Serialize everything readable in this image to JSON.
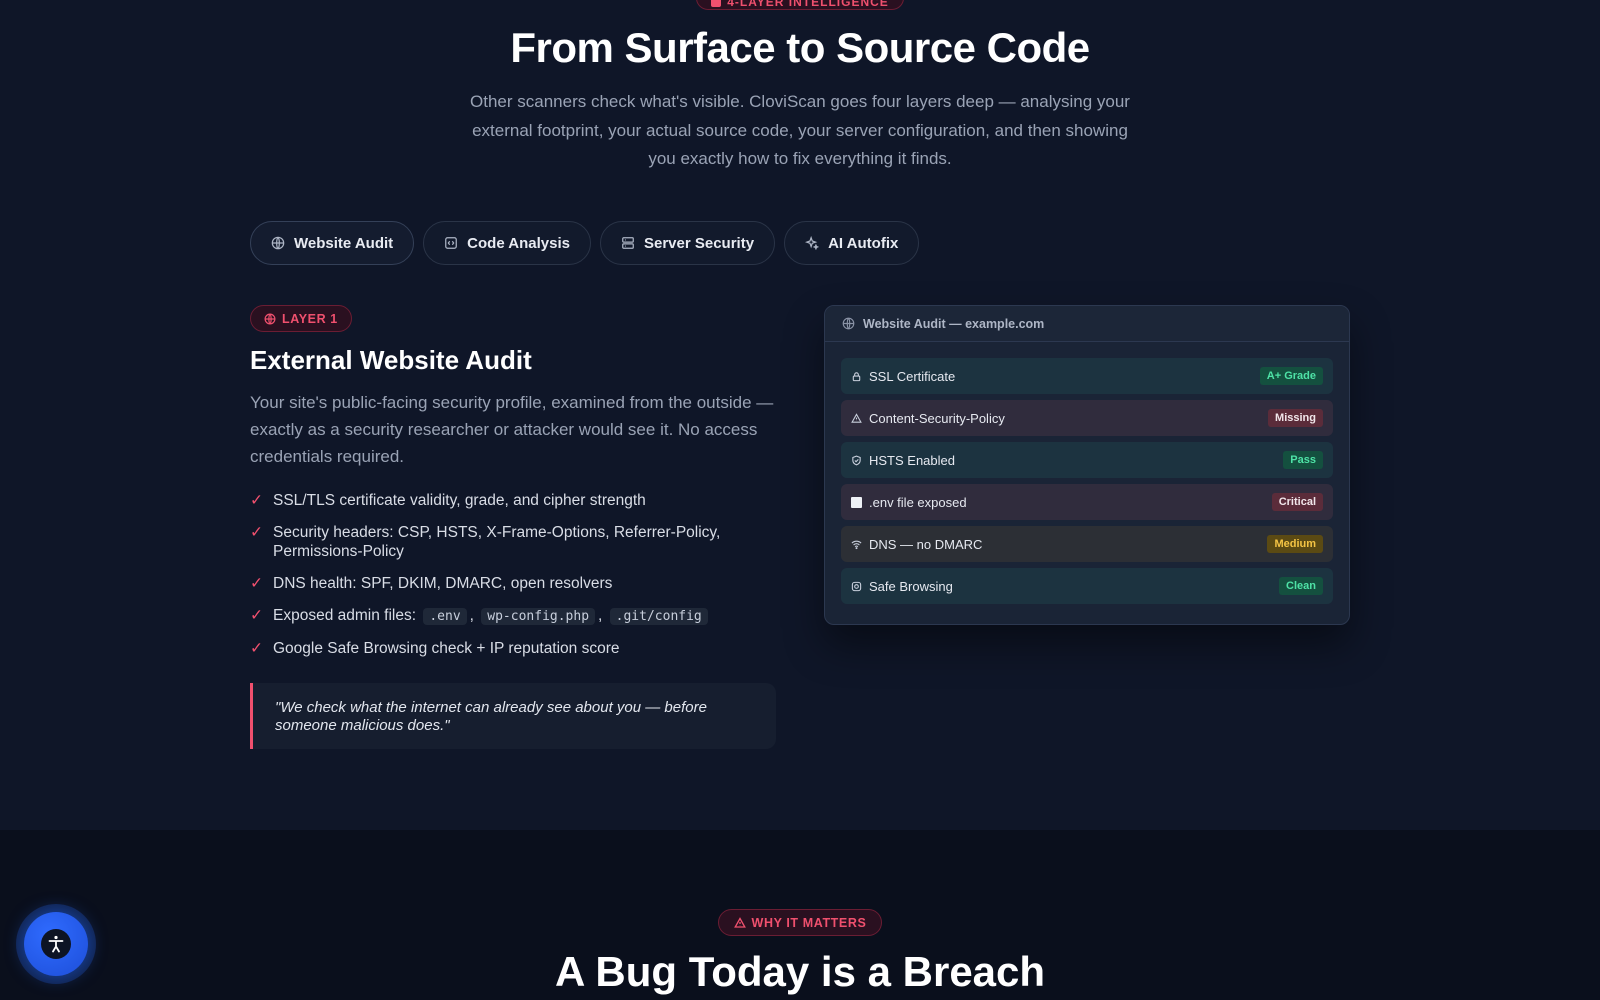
{
  "hero": {
    "eyebrow": "4-LAYER INTELLIGENCE",
    "title": "From Surface to Source Code",
    "subtitle": "Other scanners check what's visible. CloviScan goes four layers deep — analysing your external footprint, your actual source code, your server configuration, and then showing you exactly how to fix everything it finds."
  },
  "tabs": [
    {
      "label": "Website Audit",
      "icon": "globe-icon",
      "active": true
    },
    {
      "label": "Code Analysis",
      "icon": "code-icon",
      "active": false
    },
    {
      "label": "Server Security",
      "icon": "server-icon",
      "active": false
    },
    {
      "label": "AI Autofix",
      "icon": "sparkle-icon",
      "active": false
    }
  ],
  "layer": {
    "badge": "LAYER 1",
    "title": "External Website Audit",
    "description": "Your site's public-facing security profile, examined from the outside — exactly as a security researcher or attacker would see it. No access credentials required.",
    "features": [
      "SSL/TLS certificate validity, grade, and cipher strength",
      "Security headers: CSP, HSTS, X-Frame-Options, Referrer-Policy, Permissions-Policy",
      "DNS health: SPF, DKIM, DMARC, open resolvers"
    ],
    "files_label": "Exposed admin files:",
    "files": [
      ".env",
      "wp-config.php",
      ".git/config"
    ],
    "files_sep": ",",
    "last_feature": "Google Safe Browsing check + IP reputation score",
    "check_glyph": "✓",
    "quote": "\"We check what the internet can already see about you — before someone malicious does.\""
  },
  "panel": {
    "title": "Website Audit — example.com",
    "rows": [
      {
        "label": "SSL Certificate",
        "status": "A+ Grade",
        "icon": "lock-icon",
        "tone": "ok"
      },
      {
        "label": "Content-Security-Policy",
        "status": "Missing",
        "icon": "warning-icon",
        "tone": "bad"
      },
      {
        "label": "HSTS Enabled",
        "status": "Pass",
        "icon": "shield-icon",
        "tone": "ok"
      },
      {
        "label": ".env file exposed",
        "status": "Critical",
        "icon": "square-icon",
        "tone": "bad"
      },
      {
        "label": "DNS — no DMARC",
        "status": "Medium",
        "icon": "wifi-icon",
        "tone": "warn"
      },
      {
        "label": "Safe Browsing",
        "status": "Clean",
        "icon": "target-icon",
        "tone": "ok"
      }
    ]
  },
  "why": {
    "badge": "WHY IT MATTERS",
    "title": "A Bug Today is a Breach"
  },
  "colors": {
    "accent": "#f0506e",
    "background": "#0f1628",
    "success": "#4ee2a6",
    "warning": "#f4c444"
  },
  "a11y": {
    "icon": "accessibility-icon"
  }
}
